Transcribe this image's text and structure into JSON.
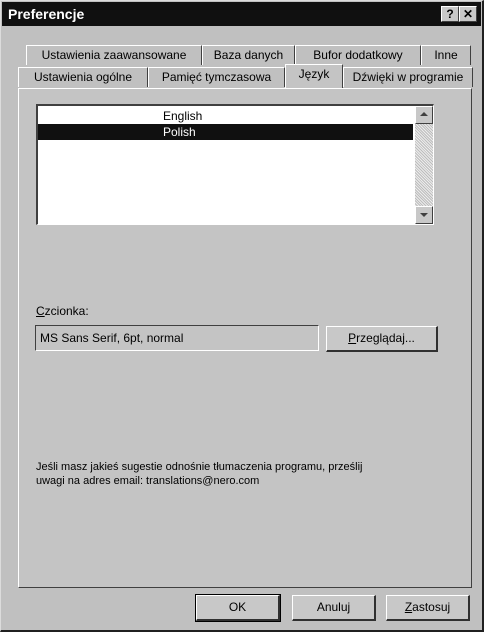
{
  "window": {
    "title": "Preferencje",
    "help_label": "?",
    "close_label": "✕"
  },
  "tabs_back": [
    "Ustawienia zaawansowane",
    "Baza danych",
    "Bufor dodatkowy",
    "Inne"
  ],
  "tabs_front": [
    "Ustawienia ogólne",
    "Pamięć tymczasowa",
    "Język",
    "Dźwięki w programie"
  ],
  "active_tab": "Język",
  "languages": {
    "items": [
      "English",
      "Polish"
    ],
    "selected": "Polish"
  },
  "font": {
    "label_underlined": "C",
    "label_rest": "zcionka:",
    "value": "MS Sans Serif, 6pt, normal",
    "browse_underlined": "P",
    "browse_rest": "rzeglądaj..."
  },
  "info": {
    "line1": "Jeśli masz jakieś sugestie odnośnie tłumaczenia programu, prześlij",
    "line2": "uwagi na adres email: translations@nero.com"
  },
  "buttons": {
    "ok": "OK",
    "cancel": "Anuluj",
    "apply_underlined": "Z",
    "apply_rest": "astosuj"
  }
}
